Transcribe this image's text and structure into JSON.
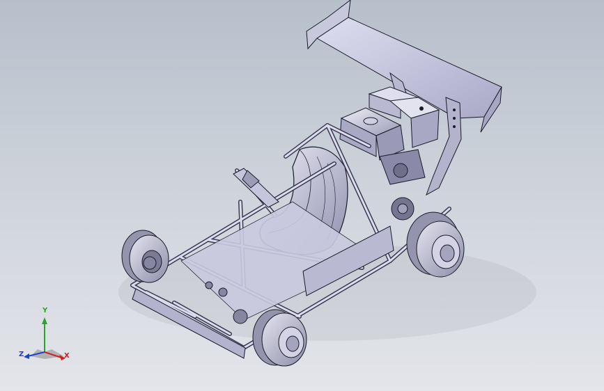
{
  "viewport": {
    "background_top": "#b7bfcb",
    "background_bottom": "#e3e5ea",
    "model_shade": "#c9c9e0",
    "model_edge": "#1a1a2a"
  },
  "triad": {
    "x_label": "X",
    "y_label": "Y",
    "z_label": "Z",
    "x_color": "#d02020",
    "y_color": "#2aa52a",
    "z_color": "#2040d0"
  }
}
